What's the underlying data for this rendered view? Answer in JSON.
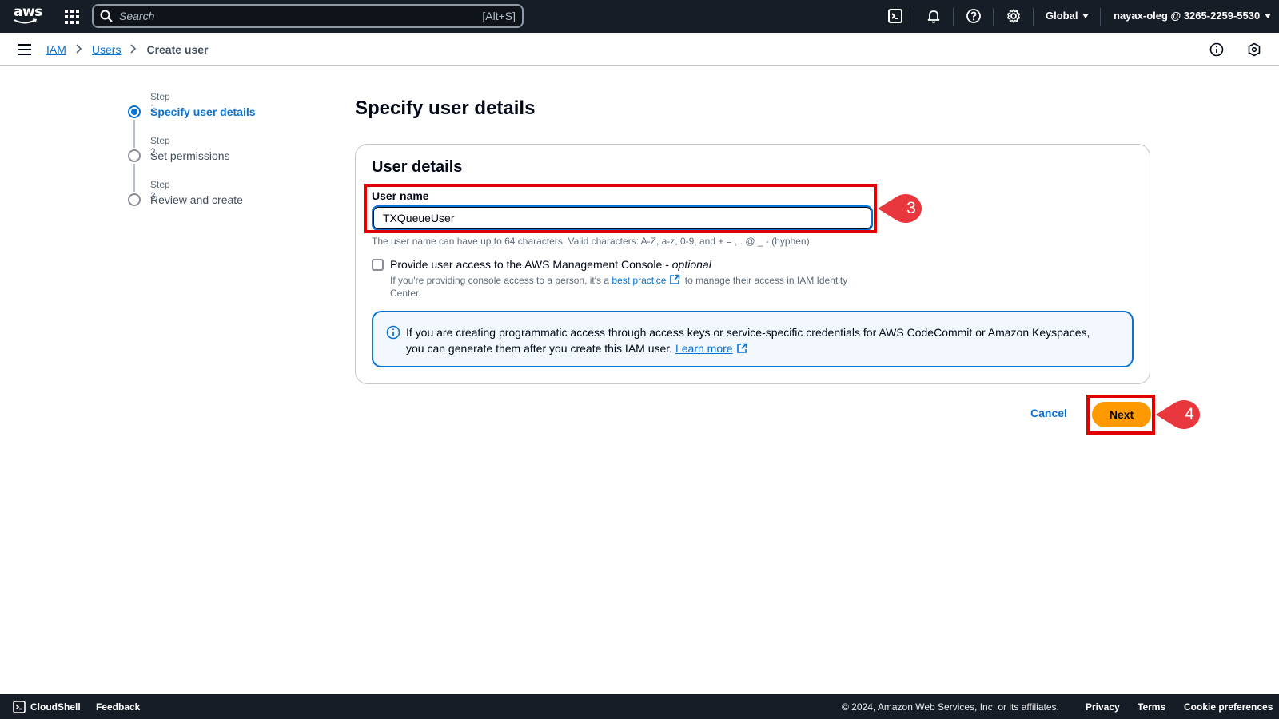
{
  "topnav": {
    "logo_text": "aws",
    "search_placeholder": "Search",
    "search_shortcut": "[Alt+S]",
    "region": "Global",
    "account": "nayax-oleg @ 3265-2259-5530"
  },
  "breadcrumb": {
    "items": [
      "IAM",
      "Users",
      "Create user"
    ]
  },
  "steps": [
    {
      "number": "Step 1",
      "label": "Specify user details",
      "active": true
    },
    {
      "number": "Step 2",
      "label": "Set permissions",
      "active": false
    },
    {
      "number": "Step 3",
      "label": "Review and create",
      "active": false
    }
  ],
  "page": {
    "title": "Specify user details"
  },
  "user_details": {
    "title": "User details",
    "user_name_label": "User name",
    "user_name_value": "TXQueueUser",
    "user_name_hint": "The user name can have up to 64 characters. Valid characters: A-Z, a-z, 0-9, and + = , . @ _ - (hyphen)",
    "console_access_label": "Provide user access to the AWS Management Console -",
    "console_access_optional": "optional",
    "console_access_checked": false,
    "console_desc_pre": "If you're providing console access to a person, it's a",
    "console_desc_link": "best practice",
    "console_desc_post": "to manage their access in IAM Identity Center."
  },
  "info_alert": {
    "text": "If you are creating programmatic access through access keys or service-specific credentials for AWS CodeCommit or Amazon Keyspaces, you can generate them after you create this IAM user.",
    "link": "Learn more"
  },
  "actions": {
    "cancel": "Cancel",
    "next": "Next"
  },
  "annotations": [
    {
      "number": "3",
      "target": "User name"
    },
    {
      "number": "4",
      "target": "Next"
    }
  ],
  "footer": {
    "cloudshell": "CloudShell",
    "feedback": "Feedback",
    "copyright": "© 2024, Amazon Web Services, Inc. or its affiliates.",
    "privacy": "Privacy",
    "terms": "Terms",
    "cookie": "Cookie preferences"
  },
  "colors": {
    "nav_bg": "#161d26",
    "link_blue": "#0972d3",
    "primary_button": "#ff9900",
    "annotation_red": "#e00000",
    "info_bg": "#f2f8fd"
  }
}
